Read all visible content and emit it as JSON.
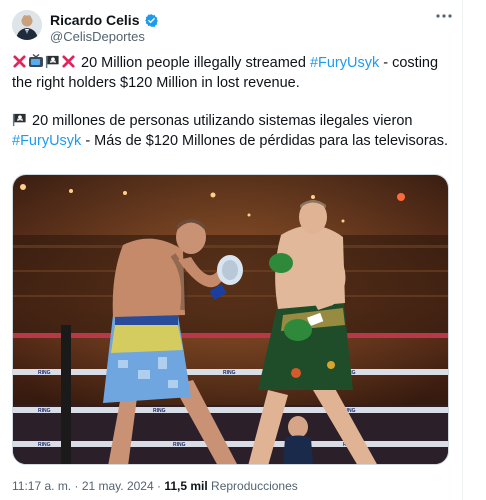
{
  "author": {
    "display_name": "Ricardo Celis",
    "handle": "@CelisDeportes",
    "verified": true
  },
  "tweet": {
    "line_en_text": " 20 Million people illegally streamed ",
    "line_en_hashtag": "#FuryUsyk",
    "line_en_rest": " - costing the right holders $120 Million in lost revenue.",
    "line_es_text": " 20 millones de personas utilizando sistemas ilegales vieron ",
    "line_es_hashtag": "#FuryUsyk",
    "line_es_rest": " - Más de $120 Millones de pérdidas para las televisoras.",
    "emojis": [
      "cross-mark",
      "television",
      "pirate-flag",
      "cross-mark"
    ]
  },
  "media": {
    "description_icon": "boxing-photo",
    "ring_text": "RING"
  },
  "footer": {
    "time": "11:17 a. m.",
    "separator": " · ",
    "date": "21 may. 2024",
    "views_count": "11,5 mil",
    "views_label": " Reproducciones"
  },
  "colors": {
    "link": "#1d9bf0",
    "verified": "#1d9bf0",
    "muted": "#536471"
  }
}
